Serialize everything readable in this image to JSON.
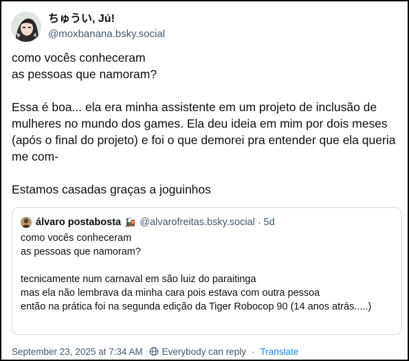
{
  "author": {
    "display_name": "ちゅうい, Jú!",
    "handle": "@moxbanana.bsky.social"
  },
  "post": {
    "text": "como vocês conheceram\nas pessoas que namoram?\n\nEssa é boa... ela era minha assistente em um projeto de inclusão de mulheres no mundo dos games. Ela deu ideia em mim por dois meses (após o final do projeto) e foi o que demorei pra entender que ela queria me com-\n\nEstamos casadas graças a joguinhos"
  },
  "quote": {
    "display_name": "álvaro postabosta",
    "emoji": "🚂",
    "handle": "@alvarofreitas.bsky.social",
    "separator": "·",
    "time": "5d",
    "text": "como vocês conheceram\nas pessoas que namoram?\n\ntecnicamente num carnaval em são luiz do paraitinga\nmas ela não lembrava da minha cara pois estava com outra pessoa\nentão na prática foi na segunda edição da Tiger Robocop 90 (14 anos atrás.....)"
  },
  "footer": {
    "timestamp": "September 23, 2025 at 7:34 AM",
    "reply_setting_icon": "globe-icon",
    "reply_setting": "Everybody can reply",
    "separator": "·",
    "translate": "Translate"
  },
  "colors": {
    "text": "#0b0f14",
    "muted": "#42576c",
    "link": "#1083fe",
    "border": "#d4dbe2"
  }
}
